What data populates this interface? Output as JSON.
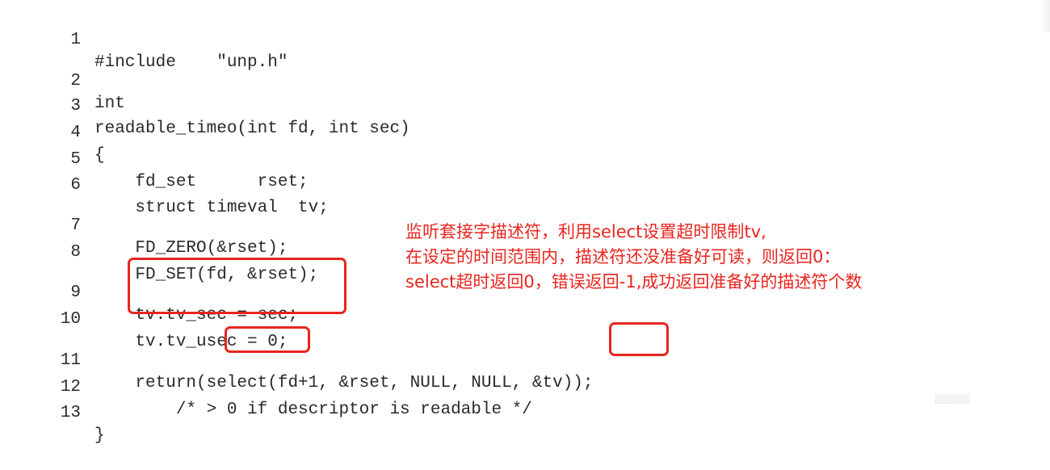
{
  "code_listing": {
    "lines": [
      {
        "num": "1",
        "text": "#include    \"unp.h\""
      },
      {
        "num": "2",
        "text": "int"
      },
      {
        "num": "3",
        "text": "readable_timeo(int fd, int sec)"
      },
      {
        "num": "4",
        "text": "{"
      },
      {
        "num": "5",
        "text": "    fd_set      rset;"
      },
      {
        "num": "6",
        "text": "    struct timeval  tv;"
      },
      {
        "num": "7",
        "text": "    FD_ZERO(&rset);"
      },
      {
        "num": "8",
        "text": "    FD_SET(fd, &rset);"
      },
      {
        "num": "9",
        "text": "    tv.tv_sec = sec;"
      },
      {
        "num": "10",
        "text": "    tv.tv_usec = 0;"
      },
      {
        "num": "11",
        "text": "    return(select(fd+1, &rset, NULL, NULL, &tv));"
      },
      {
        "num": "12",
        "text": "        /* > 0 if descriptor is readable */"
      },
      {
        "num": "13",
        "text": "}"
      }
    ]
  },
  "annotation": {
    "lines": [
      "监听套接字描述符，利用select设置超时限制tv,",
      "在设定的时间范围内，描述符还没准备好可读，则返回0：",
      "select超时返回0，错误返回-1,成功返回准备好的描述符个数"
    ],
    "color": "#e8251f"
  }
}
